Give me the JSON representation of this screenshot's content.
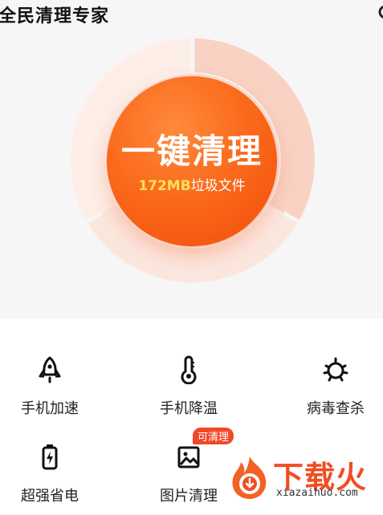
{
  "header": {
    "app_title": "全民清理专家"
  },
  "clean": {
    "main_label": "一键清理",
    "junk_amount": "172MB",
    "junk_suffix": "垃圾文件"
  },
  "tools": [
    {
      "label": "手机加速",
      "icon": "rocket-icon"
    },
    {
      "label": "手机降温",
      "icon": "thermometer-icon"
    },
    {
      "label": "病毒查杀",
      "icon": "virus-icon"
    },
    {
      "label": "超强省电",
      "icon": "battery-icon"
    },
    {
      "label": "图片清理",
      "icon": "image-icon",
      "badge": "可清理"
    }
  ],
  "watermark": {
    "name": "下载火",
    "url": "xiazaihuo.com",
    "icon": "fire-logo-icon"
  },
  "colors": {
    "accent": "#f24d0a",
    "badge": "#f0492a",
    "highlight": "#ffe15a",
    "ring_light": "#fbe4dc",
    "ring_dark": "#f7c7b8"
  }
}
